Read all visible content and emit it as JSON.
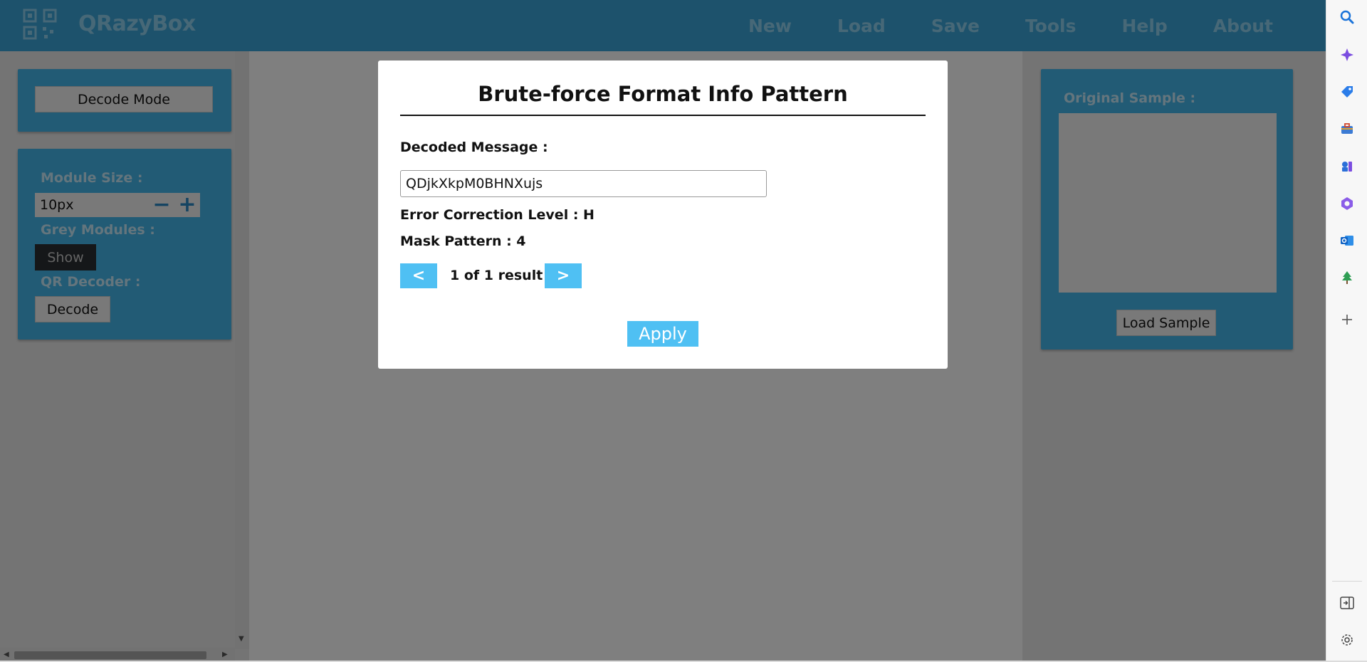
{
  "app": {
    "name": "QRazyBox",
    "nav": [
      "New",
      "Load",
      "Save",
      "Tools",
      "Help",
      "About"
    ]
  },
  "left_panel": {
    "decode_mode_label": "Decode Mode",
    "module_size_label": "Module Size :",
    "module_size_value": "10px",
    "minus_glyph": "−",
    "plus_glyph": "+",
    "grey_modules_label": "Grey Modules :",
    "show_label": "Show",
    "qr_decoder_label": "QR Decoder :",
    "decode_label": "Decode"
  },
  "right_panel": {
    "original_sample_label": "Original Sample :",
    "load_sample_label": "Load Sample"
  },
  "modal": {
    "title": "Brute-force Format Info Pattern",
    "decoded_message_label": "Decoded Message :",
    "decoded_message_value": "QDjkXkpM0BHNXujs",
    "error_correction_label": "Error Correction Level : H",
    "mask_pattern_label": "Mask Pattern : 4",
    "prev_label": "<",
    "next_label": ">",
    "result_text": "1 of 1 result",
    "apply_label": "Apply"
  },
  "browser_sidebar": {
    "icons": [
      "search-icon",
      "copilot-icon",
      "shopping-tag-icon",
      "toolbox-icon",
      "games-icon",
      "microsoft365-icon",
      "outlook-icon",
      "tree-icon",
      "add-icon",
      "sidebar-toggle-icon",
      "settings-icon"
    ]
  },
  "colors": {
    "header": "#3ba4d8",
    "panel": "#44b6ea",
    "accent_button": "#4fc0f3",
    "overlay": "rgba(0,0,0,0.5)"
  }
}
